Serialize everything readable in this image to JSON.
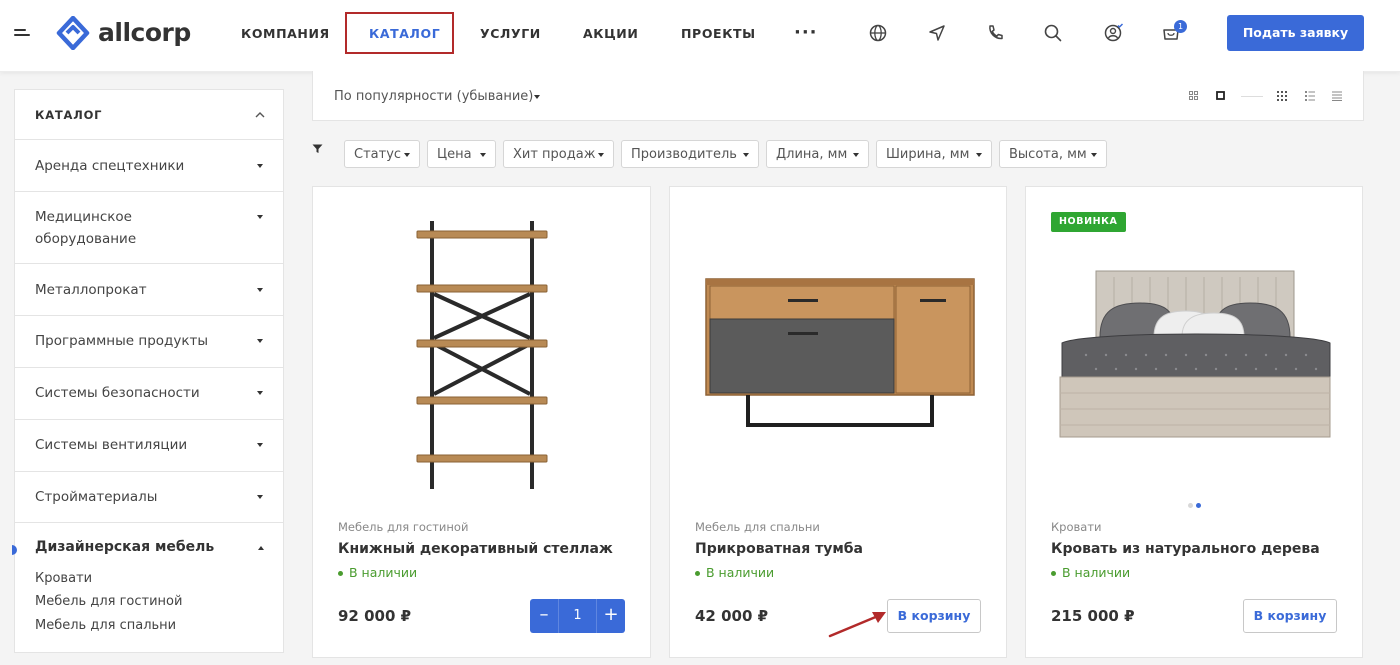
{
  "header": {
    "logo_text": "allcorp",
    "nav": [
      {
        "label": "КОМПАНИЯ"
      },
      {
        "label": "КАТАЛОГ"
      },
      {
        "label": "УСЛУГИ"
      },
      {
        "label": "АКЦИИ"
      },
      {
        "label": "ПРОЕКТЫ"
      }
    ],
    "more_label": "···",
    "icons": [
      "globe-icon",
      "location-icon",
      "phone-icon",
      "search-icon",
      "user-icon",
      "cart-icon"
    ],
    "cart_count": "1",
    "cta_label": "Подать заявку"
  },
  "sidebar": {
    "title": "КАТАЛОГ",
    "categories": [
      {
        "label": "Аренда спецтехники"
      },
      {
        "label": "Медицинское оборудование"
      },
      {
        "label": "Металлопрокат"
      },
      {
        "label": "Программные продукты"
      },
      {
        "label": "Системы безопасности"
      },
      {
        "label": "Системы вентиляции"
      },
      {
        "label": "Стройматериалы"
      }
    ],
    "open_category": {
      "label": "Дизайнерская мебель",
      "subitems": [
        {
          "label": "Кровати"
        },
        {
          "label": "Мебель для гостиной"
        },
        {
          "label": "Мебель для спальни"
        }
      ]
    }
  },
  "main": {
    "sort_label": "По популярности (убывание)",
    "filters": [
      {
        "label": "Статус"
      },
      {
        "label": "Цена"
      },
      {
        "label": "Хит продаж"
      },
      {
        "label": "Производитель"
      },
      {
        "label": "Длина, мм"
      },
      {
        "label": "Ширина, мм"
      },
      {
        "label": "Высота, мм"
      }
    ],
    "products": [
      {
        "category": "Мебель для гостиной",
        "name": "Книжный декоративный стеллаж",
        "stock": "В наличии",
        "price": "92 000 ₽",
        "quantity": "1"
      },
      {
        "category": "Мебель для спальни",
        "name": "Прикроватная тумба",
        "stock": "В наличии",
        "price": "42 000 ₽",
        "cart_label": "В корзину"
      },
      {
        "category": "Кровати",
        "name": "Кровать из натурального дерева",
        "stock": "В наличии",
        "price": "215 000 ₽",
        "cart_label": "В корзину",
        "badge": "НОВИНКА"
      }
    ]
  },
  "colors": {
    "accent": "#3a6ad8",
    "annotation": "#b22a2a",
    "in_stock": "#4a9c2f",
    "new_badge": "#2fa632"
  }
}
